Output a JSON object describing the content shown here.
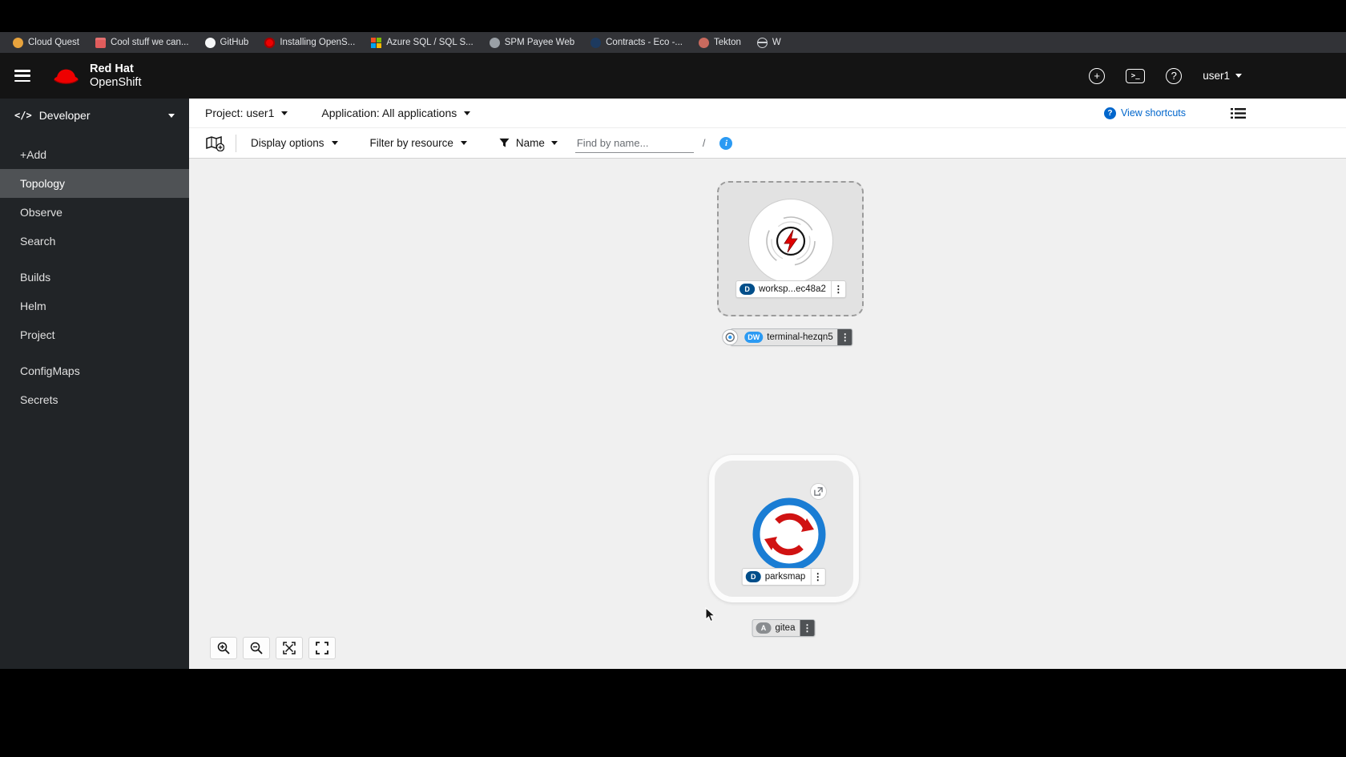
{
  "colors": {
    "accent_blue": "#0066cc",
    "masthead_bg": "#141414",
    "sidebar_bg": "#212427",
    "nav_selected_bg": "#4f5255",
    "canvas_bg": "#f0f0f0",
    "redhat_red": "#ee0000"
  },
  "bookmarks": {
    "items": [
      {
        "label": "Cloud Quest",
        "icon": "cloud-quest-favicon"
      },
      {
        "label": "Cool stuff we can...",
        "icon": "reading-list-favicon"
      },
      {
        "label": "GitHub",
        "icon": "github-favicon"
      },
      {
        "label": "Installing OpenS...",
        "icon": "openshift-favicon"
      },
      {
        "label": "Azure SQL / SQL S...",
        "icon": "azure-favicon"
      },
      {
        "label": "SPM Payee Web",
        "icon": "spm-favicon"
      },
      {
        "label": "Contracts - Eco -...",
        "icon": "contracts-favicon"
      },
      {
        "label": "Tekton",
        "icon": "tekton-favicon"
      },
      {
        "label": "W",
        "icon": "globe-favicon"
      }
    ]
  },
  "masthead": {
    "brand_top": "Red Hat",
    "brand_bottom": "OpenShift",
    "icons": [
      {
        "icon": "plus-circle-icon"
      },
      {
        "icon": "terminal-icon"
      },
      {
        "icon": "help-icon"
      }
    ],
    "user": "user1"
  },
  "sidebar": {
    "perspective": "Developer",
    "selected": "Topology",
    "items": [
      {
        "label": "+Add"
      },
      {
        "label": "Topology"
      },
      {
        "label": "Observe"
      },
      {
        "label": "Search"
      },
      {
        "label": "Builds"
      },
      {
        "label": "Helm"
      },
      {
        "label": "Project"
      },
      {
        "label": "ConfigMaps"
      },
      {
        "label": "Secrets"
      }
    ]
  },
  "context_bar": {
    "project": "Project: user1",
    "application": "Application: All applications",
    "view_shortcuts": "View shortcuts"
  },
  "toolbar": {
    "display_options": "Display options",
    "filter_by_resource": "Filter by resource",
    "name_filter": "Name",
    "find_placeholder": "Find by name...",
    "slash_hint": "/"
  },
  "topology": {
    "nodes": [
      {
        "id": "workspace",
        "badge": "D",
        "badge_color": "#004e8a",
        "label": "worksp...ec48a2"
      },
      {
        "id": "terminal",
        "badge": "DW",
        "badge_color": "#2b9af3",
        "label": "terminal-hezqn5"
      },
      {
        "id": "parksmap",
        "badge": "D",
        "badge_color": "#004e8a",
        "label": "parksmap"
      },
      {
        "id": "gitea",
        "badge": "A",
        "badge_color": "#8a8d90",
        "label": "gitea"
      }
    ],
    "zoom_controls": [
      {
        "icon": "zoom-in-icon"
      },
      {
        "icon": "zoom-out-icon"
      },
      {
        "icon": "fit-to-screen-icon"
      },
      {
        "icon": "fullscreen-icon"
      }
    ]
  }
}
